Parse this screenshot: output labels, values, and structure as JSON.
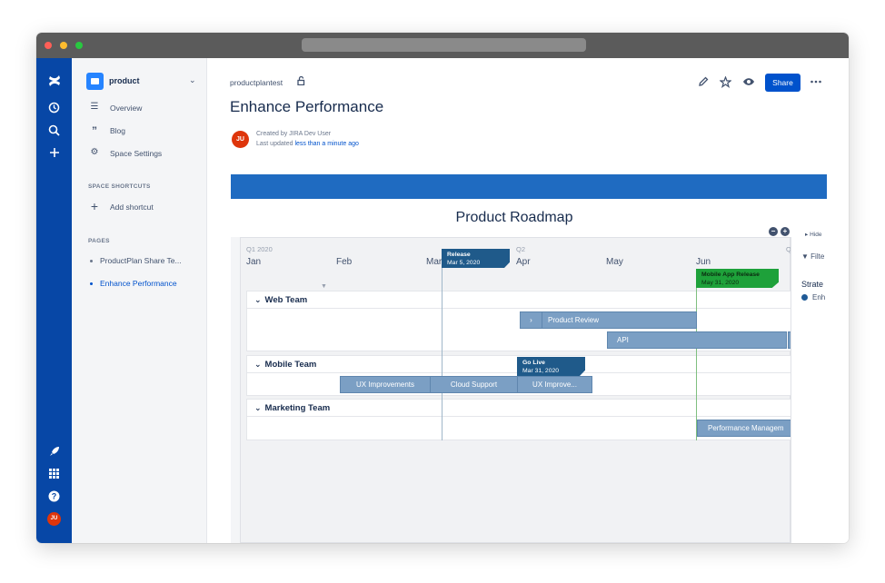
{
  "space": {
    "name": "product",
    "nav": [
      {
        "label": "Overview",
        "icon": "lines-icon"
      },
      {
        "label": "Blog",
        "icon": "quote-icon"
      },
      {
        "label": "Space Settings",
        "icon": "gear-icon"
      }
    ],
    "shortcuts_title": "SPACE SHORTCUTS",
    "add_shortcut": "Add shortcut",
    "pages_title": "PAGES",
    "pages": [
      {
        "label": "ProductPlan Share Te..."
      },
      {
        "label": "Enhance Performance"
      }
    ]
  },
  "header": {
    "breadcrumb": "productplantest",
    "title": "Enhance Performance",
    "share_label": "Share",
    "created_by": "Created by JIRA Dev User",
    "last_updated_prefix": "Last updated ",
    "last_updated_link": "less than a minute ago",
    "avatar_initials": "JU"
  },
  "globalnav": {
    "avatar_initials": "JU"
  },
  "roadmap": {
    "title": "Product Roadmap",
    "quarters": [
      "Q1 2020",
      "Q2",
      "Q"
    ],
    "months": [
      "Jan",
      "Feb",
      "Mar",
      "Apr",
      "May",
      "Jun"
    ],
    "milestones": [
      {
        "name": "Release",
        "date": "Mar 5, 2020"
      },
      {
        "name": "Mobile App Release",
        "date": "May 31, 2020"
      },
      {
        "name": "Go Live",
        "date": "Mar 31, 2020"
      }
    ],
    "lanes": [
      {
        "name": "Web Team",
        "bars": [
          "Product Review",
          "API"
        ]
      },
      {
        "name": "Mobile Team",
        "bars": [
          "UX Improvements",
          "Cloud Support",
          "UX Improve..."
        ]
      },
      {
        "name": "Marketing Team",
        "bars": [
          "Performance Managem"
        ]
      }
    ],
    "panel": {
      "hide": "Hide",
      "filter": "Filte",
      "strategy": "Strate",
      "legend": "Enh"
    }
  },
  "colors": {
    "global_nav": "#0747a6",
    "primary": "#0052cc",
    "banner": "#1f6bc1",
    "bar": "#7b9fc4",
    "milestone_blue": "#1f5a8a",
    "milestone_green": "#1ea13a"
  }
}
